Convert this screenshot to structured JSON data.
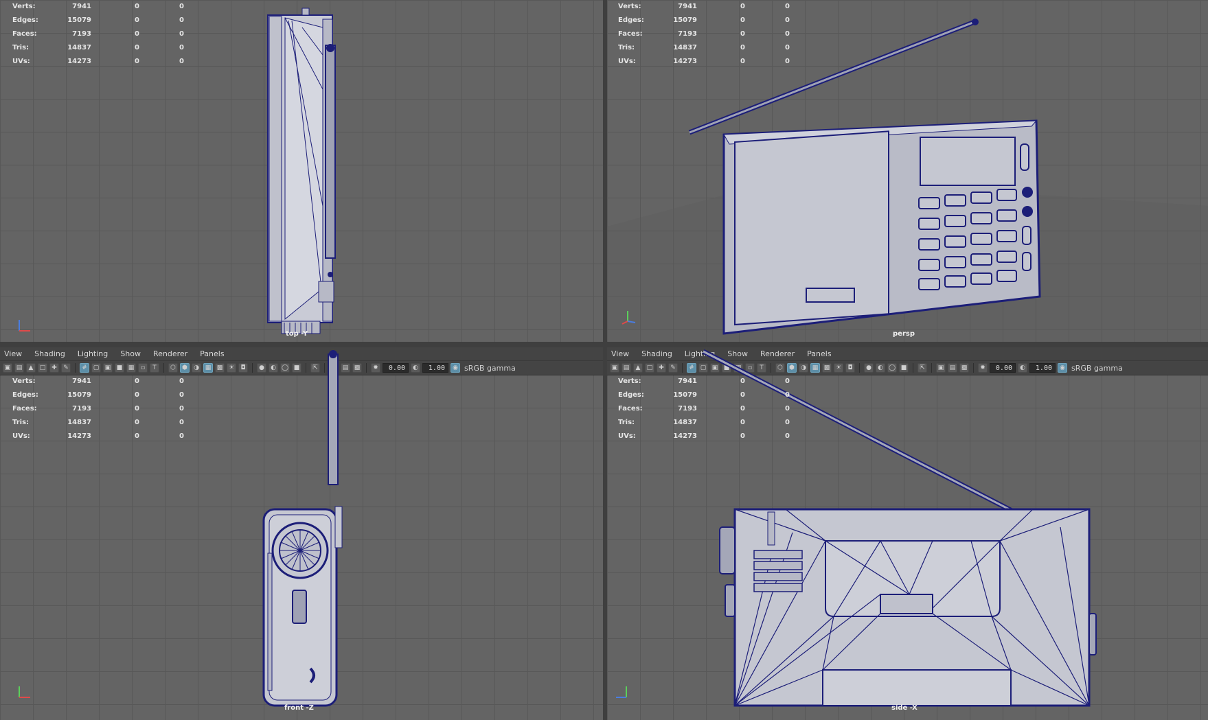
{
  "stats": [
    {
      "label": "Verts:",
      "v1": "7941",
      "v2": "0",
      "v3": "0"
    },
    {
      "label": "Edges:",
      "v1": "15079",
      "v2": "0",
      "v3": "0"
    },
    {
      "label": "Faces:",
      "v1": "7193",
      "v2": "0",
      "v3": "0"
    },
    {
      "label": "Tris:",
      "v1": "14837",
      "v2": "0",
      "v3": "0"
    },
    {
      "label": "UVs:",
      "v1": "14273",
      "v2": "0",
      "v3": "0"
    }
  ],
  "menu": [
    "View",
    "Shading",
    "Lighting",
    "Show",
    "Renderer",
    "Panels"
  ],
  "toolbar": {
    "field_a": "0.00",
    "field_b": "1.00",
    "color_space": "sRGB gamma"
  },
  "viewports": {
    "top": {
      "camera": "top -Y"
    },
    "persp": {
      "camera": "persp"
    },
    "front": {
      "camera": "front -Z"
    },
    "side": {
      "camera": "side -X"
    }
  },
  "colors": {
    "wire": "#1c1e78",
    "grid": "#585858",
    "bg": "#646464",
    "panel": "#444444",
    "accent": "#5d8fa8"
  }
}
